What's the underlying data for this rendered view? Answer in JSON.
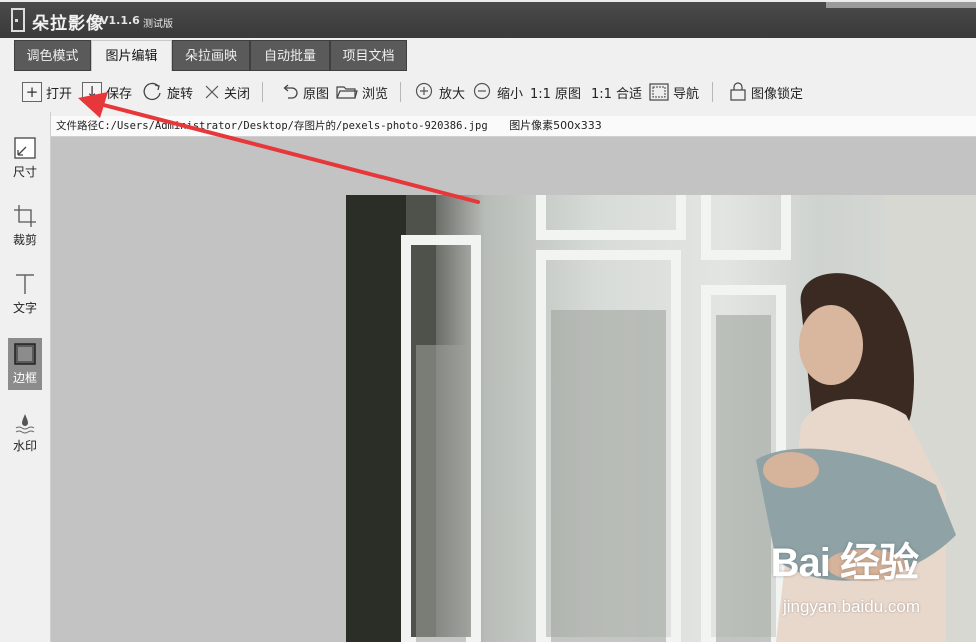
{
  "app": {
    "name": "朵拉影像",
    "version": "V1.1.6",
    "edition": "测试版"
  },
  "tabs": [
    {
      "label": "调色模式",
      "active": false
    },
    {
      "label": "图片编辑",
      "active": true
    },
    {
      "label": "朵拉画映",
      "active": false
    },
    {
      "label": "自动批量",
      "active": false
    },
    {
      "label": "项目文档",
      "active": false
    }
  ],
  "toolbar": {
    "open": "打开",
    "save": "保存",
    "rotate": "旋转",
    "close": "关闭",
    "original": "原图",
    "browse": "浏览",
    "zoom_in": "放大",
    "zoom_out": "缩小",
    "one_to_one_original": "1:1 原图",
    "one_to_one_fit": "1:1 合适",
    "navigate": "导航",
    "lock": "图像锁定"
  },
  "sidebar": {
    "items": [
      {
        "label": "尺寸",
        "icon": "resize-icon",
        "active": false
      },
      {
        "label": "裁剪",
        "icon": "crop-icon",
        "active": false
      },
      {
        "label": "文字",
        "icon": "text-icon",
        "active": false
      },
      {
        "label": "边框",
        "icon": "border-icon",
        "active": true
      },
      {
        "label": "水印",
        "icon": "watermark-icon",
        "active": false
      }
    ]
  },
  "pathbar": {
    "file_path": "文件路径C:/Users/Administrator/Desktop/存图片的/pexels-photo-920386.jpg",
    "pixels": "图片像素500x333"
  },
  "overlay": {
    "watermark": "Bai 经验",
    "watermark_url": "jingyan.baidu.com",
    "arrow_color": "#e8373a"
  },
  "colors": {
    "titlebar": "#444444",
    "tab_inactive": "#5a5a5a",
    "canvas": "#c3c3c3",
    "sidebar_active": "#8c8c8c"
  }
}
